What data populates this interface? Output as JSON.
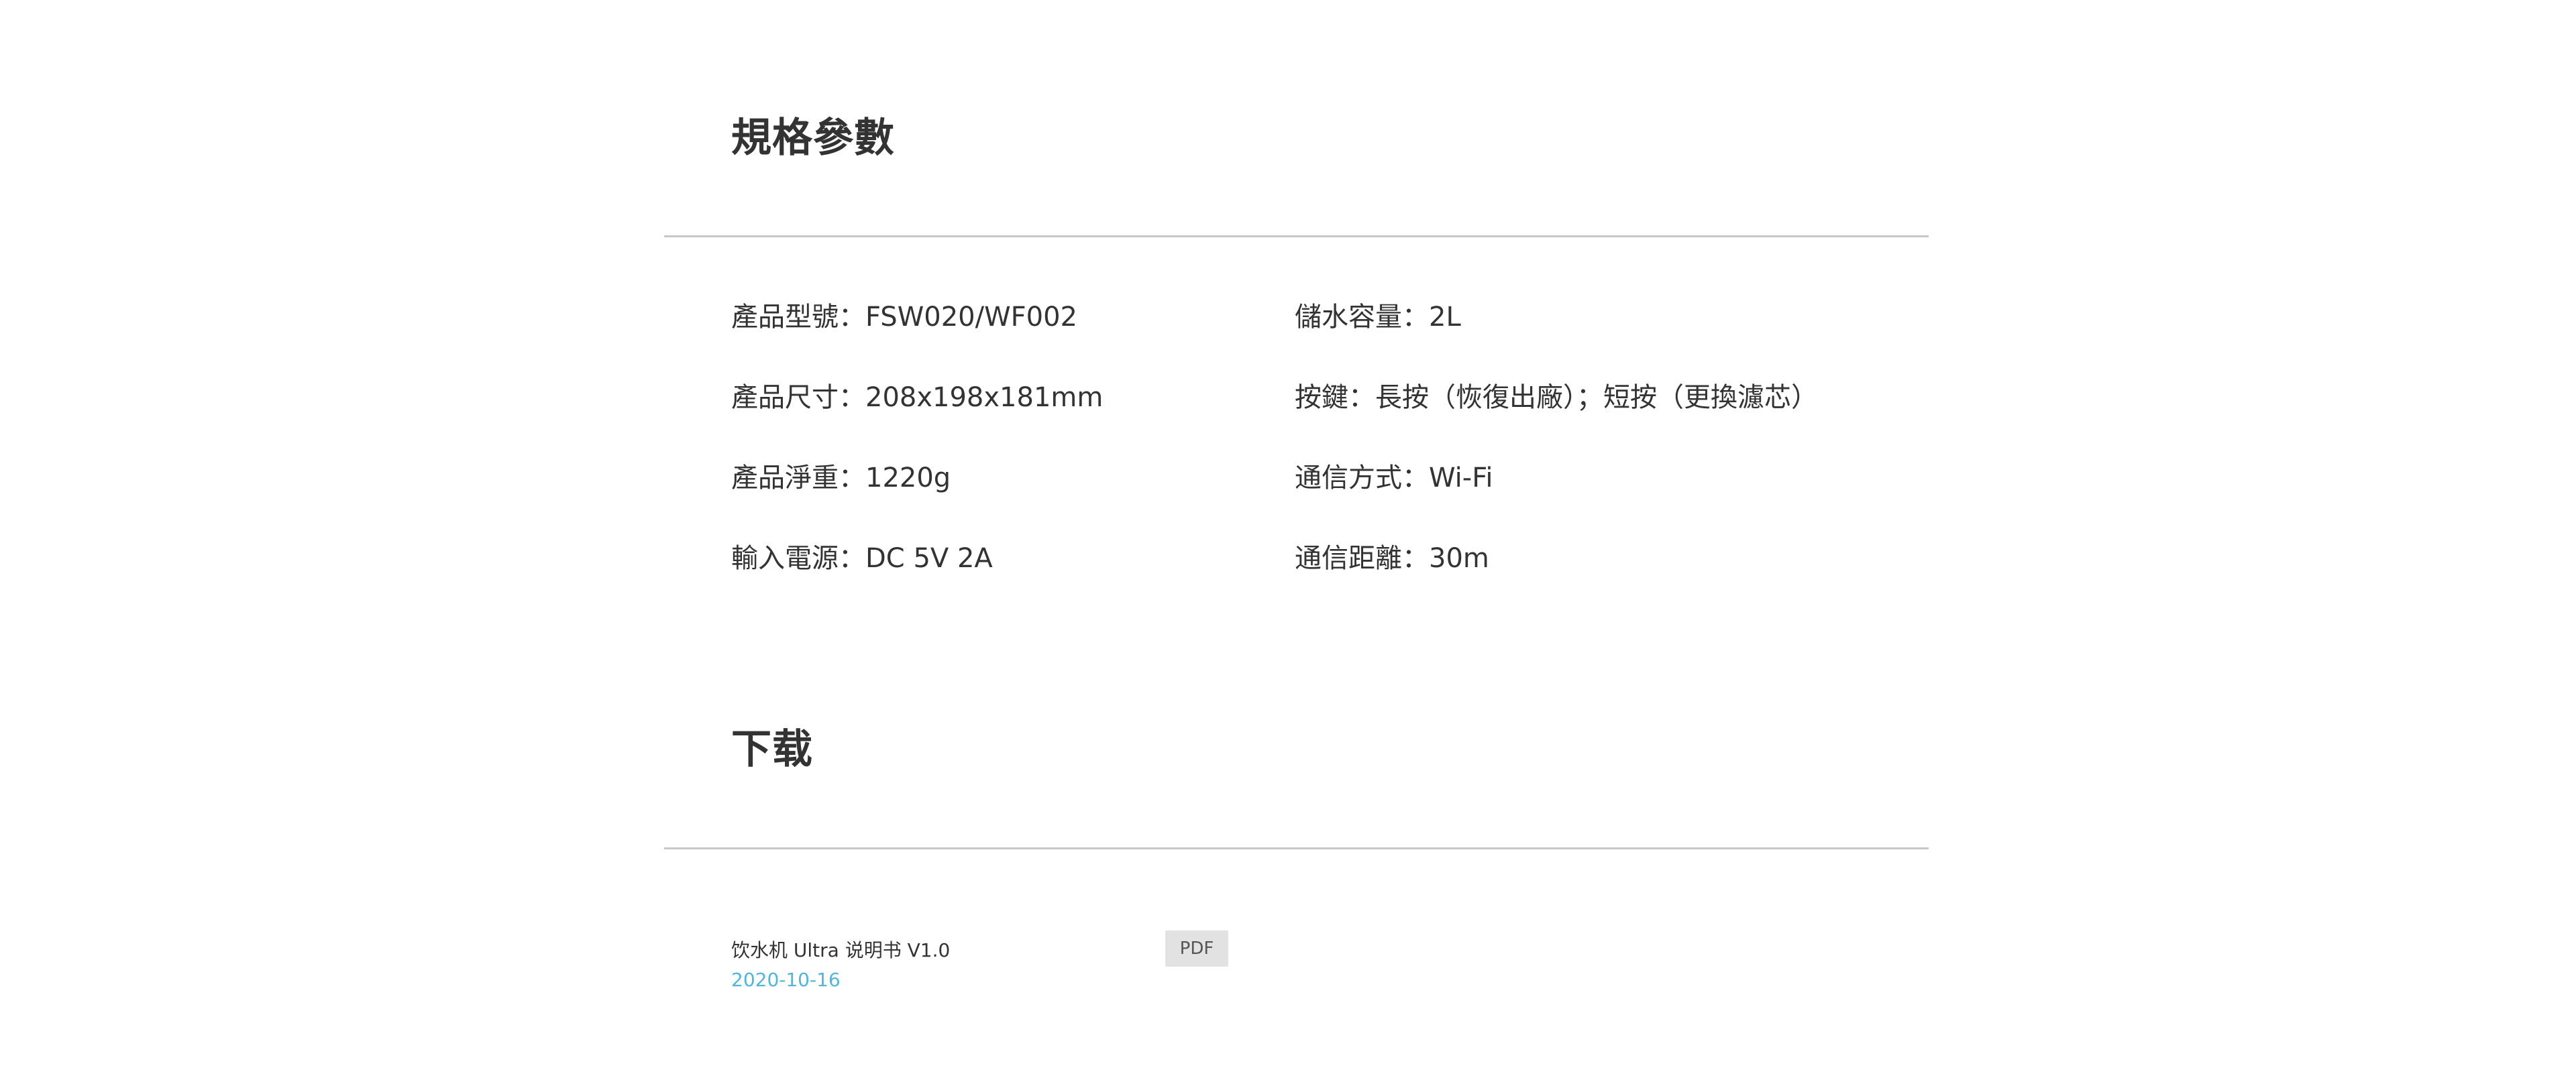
{
  "specs": {
    "title": "規格參數",
    "left": [
      {
        "label": "產品型號：",
        "value": "FSW020/WF002"
      },
      {
        "label": "產品尺寸：",
        "value": "208x198x181mm"
      },
      {
        "label": "產品淨重：",
        "value": "1220g"
      },
      {
        "label": "輸入電源：",
        "value": "DC 5V 2A"
      }
    ],
    "right": [
      {
        "label": "儲水容量：",
        "value": "2L"
      },
      {
        "label": "按鍵：",
        "value": "長按（恢復出廠）；短按（更換濾芯）"
      },
      {
        "label": "通信方式：",
        "value": "Wi-Fi"
      },
      {
        "label": "通信距離：",
        "value": "30m"
      }
    ]
  },
  "download": {
    "title": "下载",
    "items": [
      {
        "name": "饮水机 Ultra 说明书 V1.0",
        "date": "2020-10-16",
        "badge": "PDF"
      }
    ]
  },
  "colors": {
    "text": "#333333",
    "date_accent": "#4fb6e0",
    "divider": "#c8c8c8",
    "badge_bg": "#e2e2e2"
  }
}
